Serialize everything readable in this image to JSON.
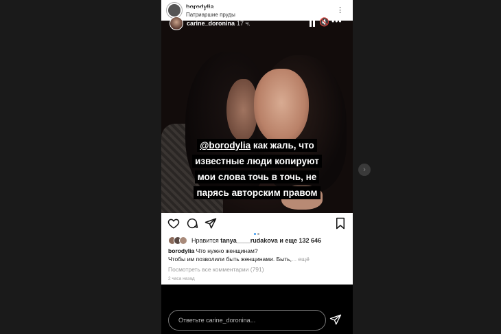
{
  "shared_post": {
    "username": "borodylia",
    "location": "Патриаршие пруды",
    "more": "⋮"
  },
  "story": {
    "username": "carine_doronina",
    "time": "17 ч.",
    "mute_icon": "mute-icon",
    "more": "•••"
  },
  "sticker": {
    "mention": "@borodylia",
    "line1_rest": " как жаль, что",
    "line2": "известные люди копируют",
    "line3": "мои слова точь в точь, не",
    "line4": "парясь авторским правом"
  },
  "post": {
    "likes_prefix": "Нравится",
    "likes_user": "tanya____rudakova",
    "likes_and": "и еще",
    "likes_count": "132 646",
    "caption_user": "borodylia",
    "caption_line1": "Что нужно женщинам?",
    "caption_line2": "Чтобы им позволили быть женщинами. Быть,",
    "caption_more": "... ещё",
    "view_comments": "Посмотреть все комментарии (791)",
    "time_ago": "2 часа назад"
  },
  "reply": {
    "placeholder": "Ответьте carine_doronina..."
  },
  "nav": {
    "next": "›"
  },
  "colors": {
    "background": "#1a1a1a",
    "accent_dot": "#3897f0"
  }
}
